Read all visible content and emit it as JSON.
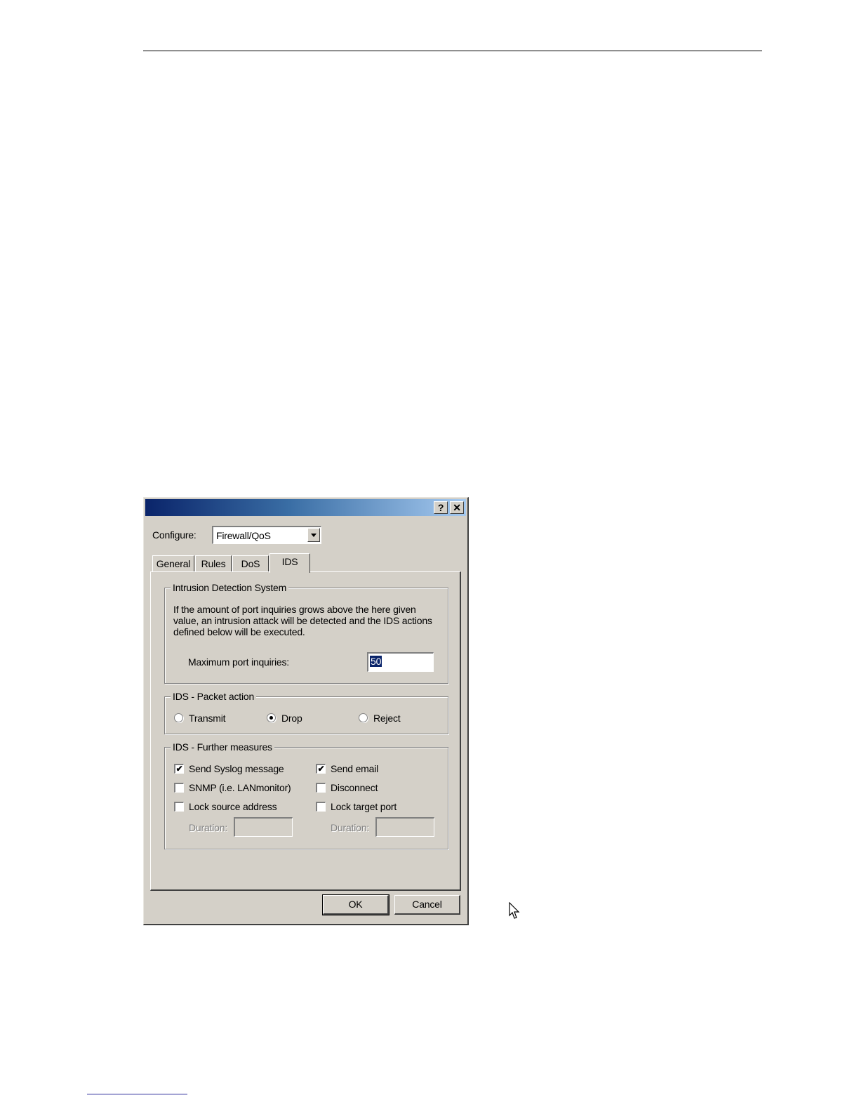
{
  "dialog": {
    "title_help": "?",
    "title_close": "✕",
    "configure_label": "Configure:",
    "configure_value": "Firewall/QoS",
    "tabs": [
      {
        "label": "General",
        "active": false
      },
      {
        "label": "Rules",
        "active": false
      },
      {
        "label": "DoS",
        "active": false
      },
      {
        "label": "IDS",
        "active": true
      }
    ],
    "ids_group": {
      "legend": "Intrusion Detection System",
      "description": "If the amount of port inquiries grows above the here given value, an intrusion attack will be detected and the IDS actions defined below will be executed.",
      "max_label": "Maximum port inquiries:",
      "max_value": "50"
    },
    "packet_group": {
      "legend": "IDS - Packet action",
      "options": [
        {
          "label": "Transmit",
          "selected": false
        },
        {
          "label": "Drop",
          "selected": true
        },
        {
          "label": "Reject",
          "selected": false
        }
      ]
    },
    "measures_group": {
      "legend": "IDS - Further measures",
      "left": [
        {
          "label": "Send Syslog message",
          "checked": true
        },
        {
          "label": "SNMP (i.e. LANmonitor)",
          "checked": false
        },
        {
          "label": "Lock source address",
          "checked": false
        }
      ],
      "right": [
        {
          "label": "Send email",
          "checked": true
        },
        {
          "label": "Disconnect",
          "checked": false
        },
        {
          "label": "Lock target port",
          "checked": false
        }
      ],
      "duration_label": "Duration:"
    },
    "ok_label": "OK",
    "cancel_label": "Cancel",
    "check_glyph": "✔"
  }
}
